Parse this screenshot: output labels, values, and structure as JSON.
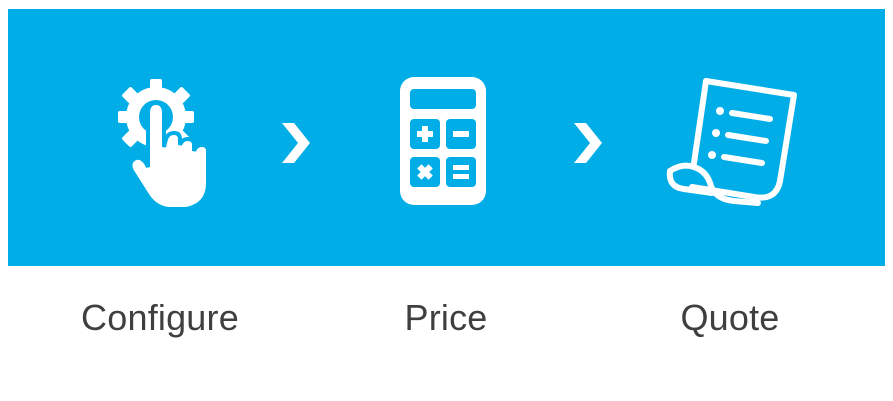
{
  "steps": [
    {
      "label": "Configure",
      "icon": "gear-hand-icon"
    },
    {
      "label": "Price",
      "icon": "calculator-icon"
    },
    {
      "label": "Quote",
      "icon": "document-list-icon"
    }
  ],
  "separator_icon": "chevron-right-icon",
  "colors": {
    "banner": "#00ade6",
    "icon": "#ffffff",
    "label": "#3f3f3f"
  }
}
